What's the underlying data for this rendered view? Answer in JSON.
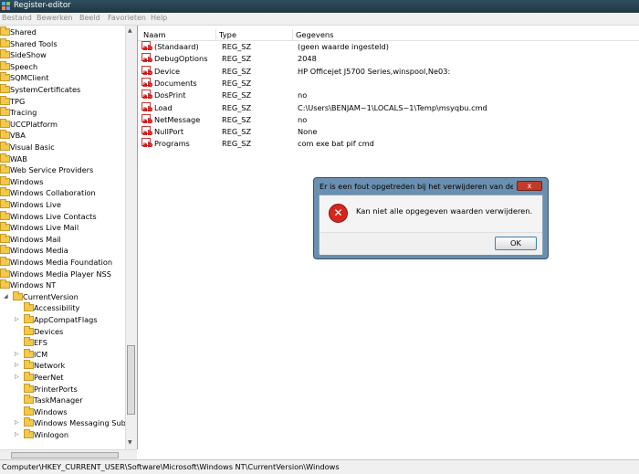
{
  "window": {
    "title": "Register-editor"
  },
  "menu": [
    "Bestand",
    "Bewerken",
    "Beeld",
    "Favorieten",
    "Help"
  ],
  "tree": [
    {
      "label": "Shared",
      "level": 0
    },
    {
      "label": "Shared Tools",
      "level": 0
    },
    {
      "label": "SideShow",
      "level": 0
    },
    {
      "label": "Speech",
      "level": 0
    },
    {
      "label": "SQMClient",
      "level": 0
    },
    {
      "label": "SystemCertificates",
      "level": 0
    },
    {
      "label": "TPG",
      "level": 0
    },
    {
      "label": "Tracing",
      "level": 0
    },
    {
      "label": "UCCPlatform",
      "level": 0
    },
    {
      "label": "VBA",
      "level": 0
    },
    {
      "label": "Visual Basic",
      "level": 0
    },
    {
      "label": "WAB",
      "level": 0
    },
    {
      "label": "Web Service Providers",
      "level": 0
    },
    {
      "label": "Windows",
      "level": 0
    },
    {
      "label": "Windows Collaboration",
      "level": 0
    },
    {
      "label": "Windows Live",
      "level": 0
    },
    {
      "label": "Windows Live Contacts",
      "level": 0
    },
    {
      "label": "Windows Live Mail",
      "level": 0
    },
    {
      "label": "Windows Mail",
      "level": 0
    },
    {
      "label": "Windows Media",
      "level": 0
    },
    {
      "label": "Windows Media Foundation",
      "level": 0
    },
    {
      "label": "Windows Media Player NSS",
      "level": 0
    },
    {
      "label": "Windows NT",
      "level": 0
    },
    {
      "label": "CurrentVersion",
      "level": 1,
      "expander": "open"
    },
    {
      "label": "Accessibility",
      "level": 2
    },
    {
      "label": "AppCompatFlags",
      "level": 2,
      "expander": "closed"
    },
    {
      "label": "Devices",
      "level": 2
    },
    {
      "label": "EFS",
      "level": 2
    },
    {
      "label": "ICM",
      "level": 2,
      "expander": "closed"
    },
    {
      "label": "Network",
      "level": 2,
      "expander": "closed"
    },
    {
      "label": "PeerNet",
      "level": 2,
      "expander": "closed"
    },
    {
      "label": "PrinterPorts",
      "level": 2
    },
    {
      "label": "TaskManager",
      "level": 2
    },
    {
      "label": "Windows",
      "level": 2
    },
    {
      "label": "Windows Messaging Subsy",
      "level": 2,
      "expander": "closed"
    },
    {
      "label": "Winlogon",
      "level": 2,
      "expander": "closed"
    }
  ],
  "columns": [
    "Naam",
    "Type",
    "Gegevens"
  ],
  "values": [
    {
      "name": "(Standaard)",
      "type": "REG_SZ",
      "data": "(geen waarde ingesteld)"
    },
    {
      "name": "DebugOptions",
      "type": "REG_SZ",
      "data": "2048"
    },
    {
      "name": "Device",
      "type": "REG_SZ",
      "data": "HP Officejet J5700 Series,winspool,Ne03:"
    },
    {
      "name": "Documents",
      "type": "REG_SZ",
      "data": ""
    },
    {
      "name": "DosPrint",
      "type": "REG_SZ",
      "data": "no"
    },
    {
      "name": "Load",
      "type": "REG_SZ",
      "data": "C:\\Users\\BENJAM~1\\LOCALS~1\\Temp\\msyqbu.cmd"
    },
    {
      "name": "NetMessage",
      "type": "REG_SZ",
      "data": "no"
    },
    {
      "name": "NullPort",
      "type": "REG_SZ",
      "data": "None"
    },
    {
      "name": "Programs",
      "type": "REG_SZ",
      "data": "com exe bat pif cmd"
    }
  ],
  "dialog": {
    "title": "Er is een fout opgetreden bij het verwijderen van de wa...",
    "message": "Kan niet alle opgegeven waarden verwijderen.",
    "ok_label": "OK",
    "close_glyph": "x"
  },
  "status": {
    "path": "Computer\\HKEY_CURRENT_USER\\Software\\Microsoft\\Windows NT\\CurrentVersion\\Windows"
  }
}
